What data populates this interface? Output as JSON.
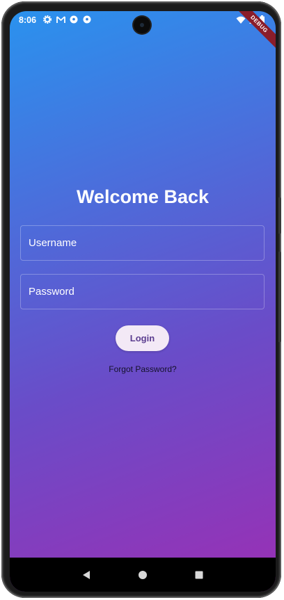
{
  "status_bar": {
    "time": "8:06",
    "notification_icons": [
      "settings-icon",
      "gmail-icon",
      "soccer-ball-icon",
      "soccer-ball-icon"
    ],
    "system_icons": [
      "wifi-icon",
      "signal-icon",
      "battery-icon"
    ]
  },
  "debug_banner": "DEBUG",
  "login": {
    "title": "Welcome Back",
    "username_label": "Username",
    "password_label": "Password",
    "login_button": "Login",
    "forgot_password": "Forgot Password?"
  },
  "colors": {
    "gradient_start": "#2a92ee",
    "gradient_end": "#9b2fb4",
    "button_bg": "#f3e9f6",
    "button_text": "#5b3d8f"
  },
  "nav_bar": {
    "buttons": [
      "back-icon",
      "home-icon",
      "recents-icon"
    ]
  }
}
